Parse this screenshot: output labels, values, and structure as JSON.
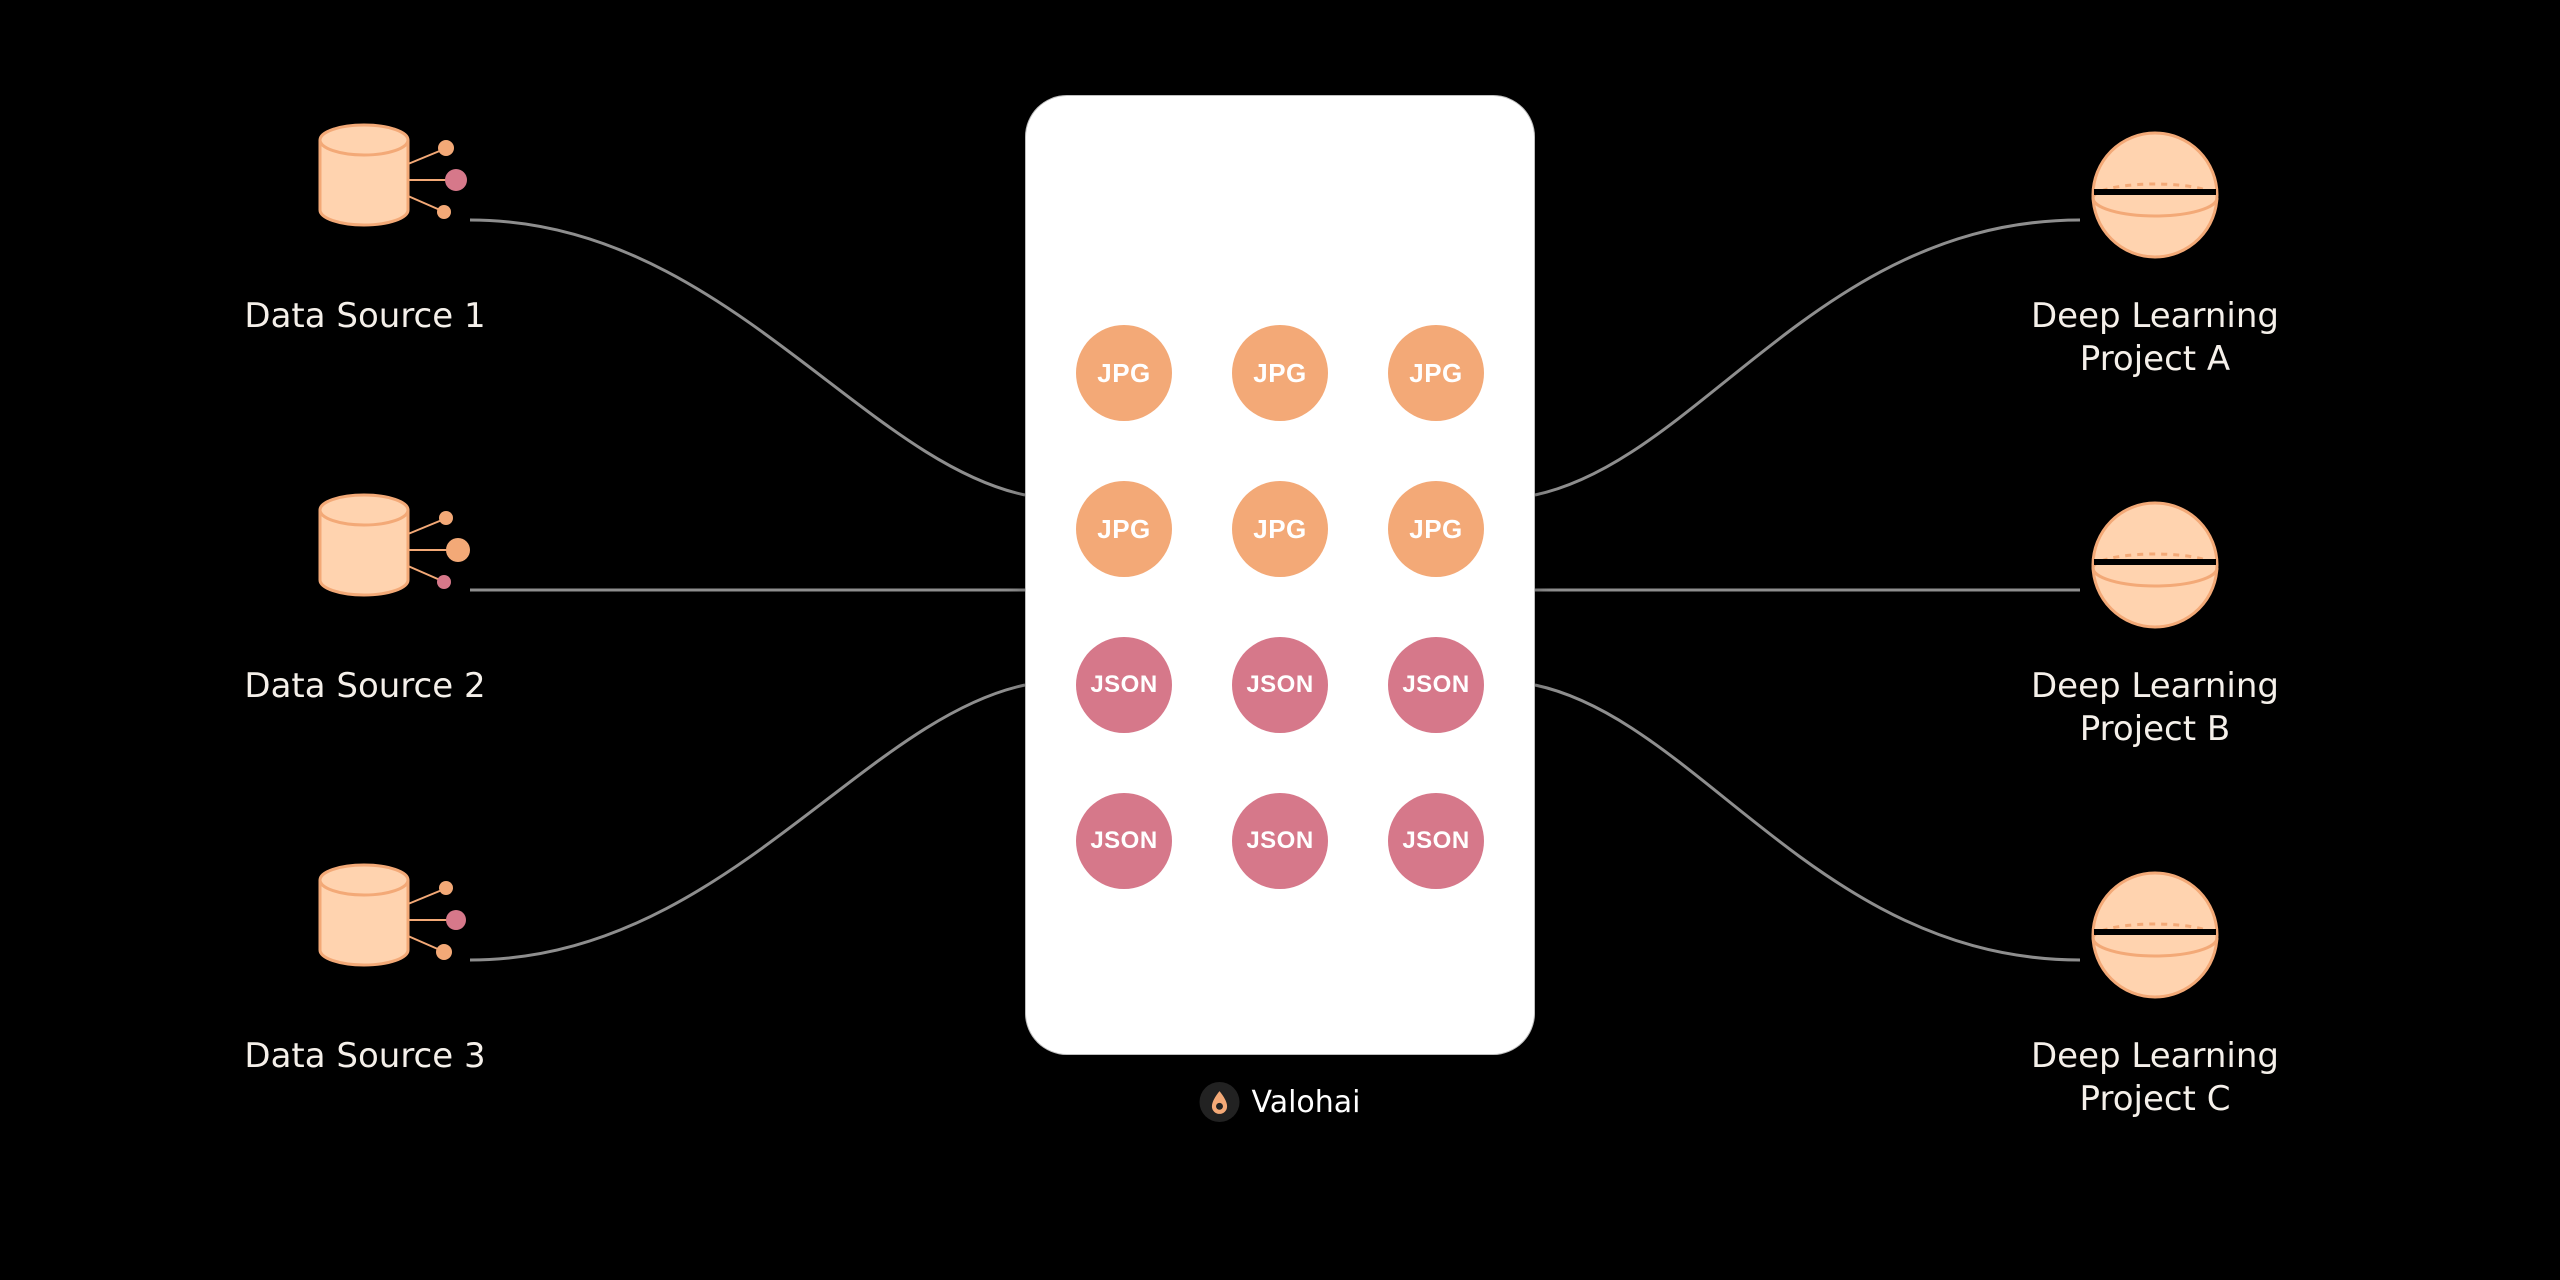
{
  "colors": {
    "bg": "#000000",
    "text": "#F2EDE7",
    "wire": "#8E8E8E",
    "peach": "#FFD3AF",
    "peachStroke": "#F3A977",
    "jpg": "#F3A977",
    "json": "#D6788A",
    "dotPink": "#D6788A",
    "dotOrange": "#F3A977"
  },
  "sources": [
    {
      "label": "Data Source 1"
    },
    {
      "label": "Data Source 2"
    },
    {
      "label": "Data Source 3"
    }
  ],
  "projects": [
    {
      "label": "Deep Learning\nProject A"
    },
    {
      "label": "Deep Learning\nProject B"
    },
    {
      "label": "Deep Learning\nProject C"
    }
  ],
  "store": {
    "rows": [
      [
        "JPG",
        "JPG",
        "JPG"
      ],
      [
        "JPG",
        "JPG",
        "JPG"
      ],
      [
        "JSON",
        "JSON",
        "JSON"
      ],
      [
        "JSON",
        "JSON",
        "JSON"
      ]
    ]
  },
  "brand": {
    "name": "Valohai"
  }
}
